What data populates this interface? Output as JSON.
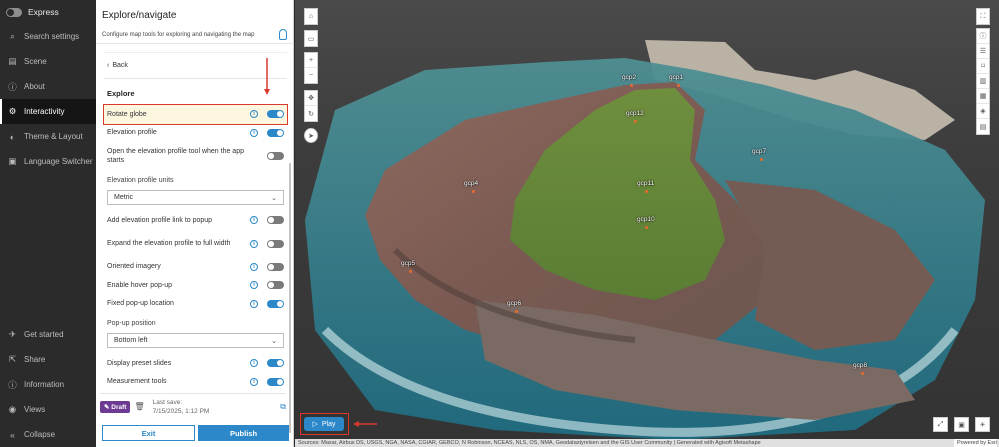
{
  "nav": {
    "title": "Express",
    "items": [
      {
        "label": "Search settings",
        "icon": "search-icon",
        "glyph": "⌕"
      },
      {
        "label": "Scene",
        "icon": "layers-icon",
        "glyph": "▤"
      },
      {
        "label": "About",
        "icon": "info-icon",
        "glyph": "ⓘ"
      },
      {
        "label": "Interactivity",
        "icon": "gear-icon",
        "glyph": "⚙"
      },
      {
        "label": "Theme & Layout",
        "icon": "palette-icon",
        "glyph": "◐"
      },
      {
        "label": "Language Switcher",
        "icon": "language-icon",
        "glyph": "▣"
      }
    ],
    "bottom": [
      {
        "label": "Get started",
        "icon": "rocket-icon",
        "glyph": "✈"
      },
      {
        "label": "Share",
        "icon": "share-icon",
        "glyph": "⇱"
      },
      {
        "label": "Information",
        "icon": "info-icon",
        "glyph": "ⓘ"
      },
      {
        "label": "Views",
        "icon": "eye-icon",
        "glyph": "◉"
      },
      {
        "label": "Collapse",
        "icon": "collapse-icon",
        "glyph": "«"
      }
    ]
  },
  "panel": {
    "title": "Explore/navigate",
    "description": "Configure map tools for exploring and navigating the map",
    "back": "Back",
    "section": "Explore",
    "rows": {
      "rotate_globe": "Rotate globe",
      "elevation_profile": "Elevation profile",
      "open_elevation": "Open the elevation profile tool when the app starts",
      "elevation_units_label": "Elevation profile units",
      "elevation_units_value": "Metric",
      "add_elevation_link": "Add elevation profile link to popup",
      "expand_elevation": "Expand the elevation profile to full width",
      "oriented_imagery": "Oriented imagery",
      "hover_popup": "Enable hover pop-up",
      "fixed_popup": "Fixed pop-up location",
      "popup_position_label": "Pop-up position",
      "popup_position_value": "Bottom left",
      "preset_slides": "Display preset slides",
      "measurement_tools": "Measurement tools"
    },
    "toggles": {
      "rotate_globe": true,
      "elevation_profile": true,
      "open_elevation": false,
      "add_elevation_link": false,
      "expand_elevation": false,
      "oriented_imagery": false,
      "hover_popup": false,
      "fixed_popup": true,
      "preset_slides": true,
      "measurement_tools": true
    },
    "status": {
      "draft": "Draft",
      "last_save_label": "Last save:",
      "last_save_value": "7/15/2025, 1:12 PM"
    },
    "exit": "Exit",
    "publish": "Publish"
  },
  "map": {
    "gcps": [
      "gcp2",
      "gcp1",
      "gcp12",
      "gcp7",
      "gcp4",
      "gcp11",
      "gcp10",
      "gcp5",
      "gcp6",
      "gcp8"
    ],
    "play": "Play",
    "attribution": "Sources: Maxar, Airbus DS, USGS, NGA, NASA, CGIAR, GEBCO, N Robinson, NCEAS, NLS, OS, NMA, Geodatastyrelsen and the GIS User Community | Generated with Agisoft Metashape",
    "powered": "Powered by Esri"
  }
}
